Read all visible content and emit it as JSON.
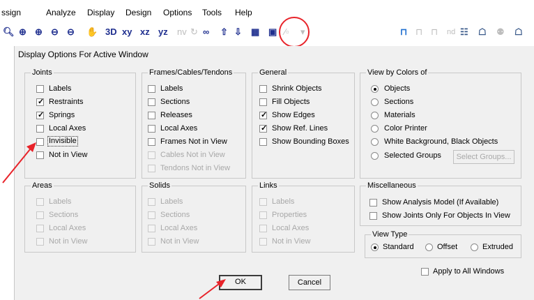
{
  "menu": [
    "ssign",
    "Analyze",
    "Display",
    "Design",
    "Options",
    "Tools",
    "Help"
  ],
  "toolbar": {
    "xy": "xy",
    "xz": "xz",
    "yz": "yz",
    "nv": "nv",
    "nd": "nd"
  },
  "dialog": {
    "title": "Display Options For Active Window",
    "joints": {
      "title": "Joints",
      "items": [
        {
          "label": "Labels",
          "checked": false
        },
        {
          "label": "Restraints",
          "checked": true
        },
        {
          "label": "Springs",
          "checked": true
        },
        {
          "label": "Local Axes",
          "checked": false
        },
        {
          "label": "Invisible",
          "checked": false
        },
        {
          "label": "Not in View",
          "checked": false
        }
      ]
    },
    "frames": {
      "title": "Frames/Cables/Tendons",
      "items": [
        {
          "label": "Labels",
          "checked": false
        },
        {
          "label": "Sections",
          "checked": false
        },
        {
          "label": "Releases",
          "checked": false
        },
        {
          "label": "Local Axes",
          "checked": false
        },
        {
          "label": "Frames Not in View",
          "checked": false
        },
        {
          "label": "Cables Not in View",
          "checked": false,
          "disabled": true
        },
        {
          "label": "Tendons Not in View",
          "checked": false,
          "disabled": true
        }
      ]
    },
    "general": {
      "title": "General",
      "items": [
        {
          "label": "Shrink Objects",
          "checked": false
        },
        {
          "label": "Fill Objects",
          "checked": false
        },
        {
          "label": "Show Edges",
          "checked": true
        },
        {
          "label": "Show Ref. Lines",
          "checked": true
        },
        {
          "label": "Show Bounding Boxes",
          "checked": false
        }
      ]
    },
    "view_by_colors": {
      "title": "View by Colors of",
      "selected": "Objects",
      "options": [
        "Objects",
        "Sections",
        "Materials",
        "Color Printer",
        "White Background, Black Objects",
        "Selected Groups"
      ],
      "select_groups_button": "Select Groups..."
    },
    "areas": {
      "title": "Areas",
      "items": [
        "Labels",
        "Sections",
        "Local Axes",
        "Not in View"
      ]
    },
    "solids": {
      "title": "Solids",
      "items": [
        "Labels",
        "Sections",
        "Local Axes",
        "Not in View"
      ]
    },
    "links": {
      "title": "Links",
      "items": [
        "Labels",
        "Properties",
        "Local Axes",
        "Not in View"
      ]
    },
    "misc": {
      "title": "Miscellaneous",
      "items": [
        {
          "label": "Show Analysis Model  (If Available)",
          "checked": false
        },
        {
          "label": "Show Joints Only For Objects In View",
          "checked": false
        }
      ]
    },
    "view_type": {
      "title": "View Type",
      "selected": "Standard",
      "options": [
        "Standard",
        "Offset",
        "Extruded"
      ]
    },
    "apply_all": {
      "label": "Apply to All Windows",
      "checked": false
    },
    "ok": "OK",
    "cancel": "Cancel"
  },
  "colors": {
    "annotation": "#e8232a",
    "dialog_bg": "#f0f0f0",
    "toolbar_icon": "#1f2f8f"
  }
}
